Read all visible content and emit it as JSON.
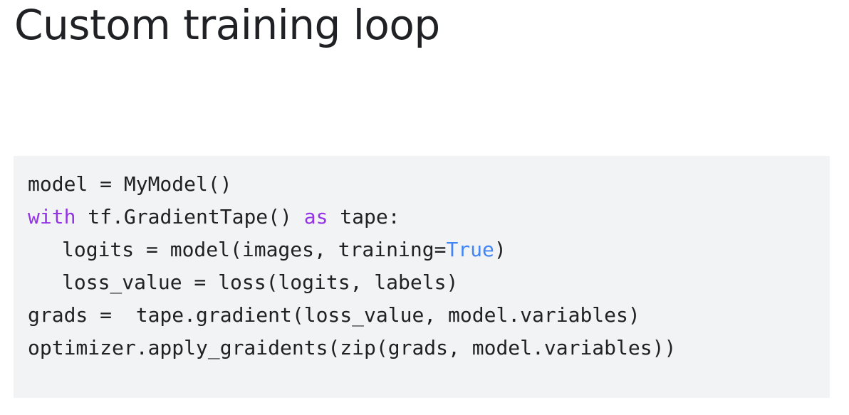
{
  "title": "Custom training loop",
  "code": {
    "line1": "model = MyModel()",
    "line2_kw_with": "with",
    "line2_mid": " tf.GradientTape() ",
    "line2_kw_as": "as",
    "line2_end": " tape:",
    "line3_start": "logits = model(images, training=",
    "line3_literal": "True",
    "line3_end": ")",
    "line4": "loss_value = loss(logits, labels)",
    "line5": "grads =  tape.gradient(loss_value, model.variables)",
    "line6": "optimizer.apply_graidents(zip(grads, model.variables))"
  },
  "colors": {
    "keyword": "#9334e6",
    "literal": "#4285f4",
    "text": "#202124",
    "code_background": "#f1f3f4"
  }
}
